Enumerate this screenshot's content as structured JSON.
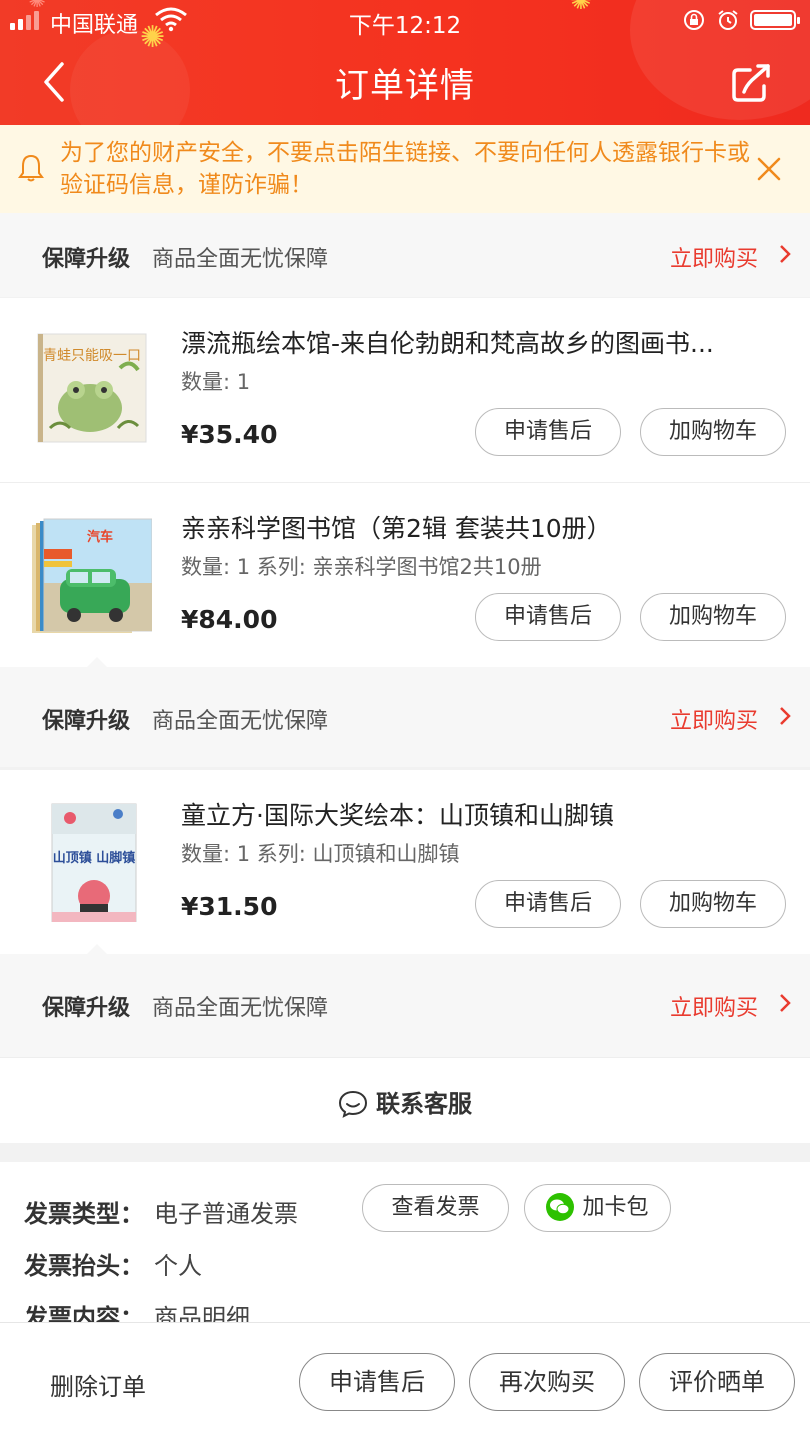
{
  "status_bar": {
    "carrier": "中国联通",
    "time": "下午12:12"
  },
  "nav": {
    "title": "订单详情"
  },
  "notice": {
    "text": "为了您的财产安全，不要点击陌生链接、不要向任何人透露银行卡或验证码信息，谨防诈骗！"
  },
  "guarantee": {
    "title": "保障升级",
    "desc": "商品全面无忧保障",
    "buy_label": "立即购买"
  },
  "products": [
    {
      "title": "漂流瓶绘本馆-来自伦勃朗和梵高故乡的图画书...",
      "meta": "数量: 1",
      "price": "¥35.40",
      "cover_text": "青蛙只能吸一口"
    },
    {
      "title": "亲亲科学图书馆（第2辑 套装共10册）",
      "meta": "数量: 1 系列: 亲亲科学图书馆2共10册",
      "price": "¥84.00",
      "cover_text": "汽车"
    },
    {
      "title": "童立方·国际大奖绘本：山顶镇和山脚镇",
      "meta": "数量: 1 系列: 山顶镇和山脚镇",
      "price": "¥31.50",
      "cover_text": "山顶镇 山脚镇"
    }
  ],
  "product_buttons": {
    "after_sale": "申请售后",
    "add_cart": "加购物车"
  },
  "contact": {
    "label": "联系客服",
    "icon": "chat-smile-icon"
  },
  "invoice": {
    "type_label": "发票类型：",
    "type_value": "电子普通发票",
    "view_button": "查看发票",
    "card_button": "加卡包",
    "header_label": "发票抬头：",
    "header_value": "个人",
    "content_label": "发票内容：",
    "content_value": "商品明细"
  },
  "bottom_bar": {
    "delete": "删除订单",
    "after_sale": "申请售后",
    "rebuy": "再次购买",
    "review": "评价晒单"
  },
  "colors": {
    "brand_red": "#f23b27",
    "accent_red": "#e93b2f",
    "notice_orange": "#f08a1c",
    "wechat_green": "#2dc100"
  }
}
